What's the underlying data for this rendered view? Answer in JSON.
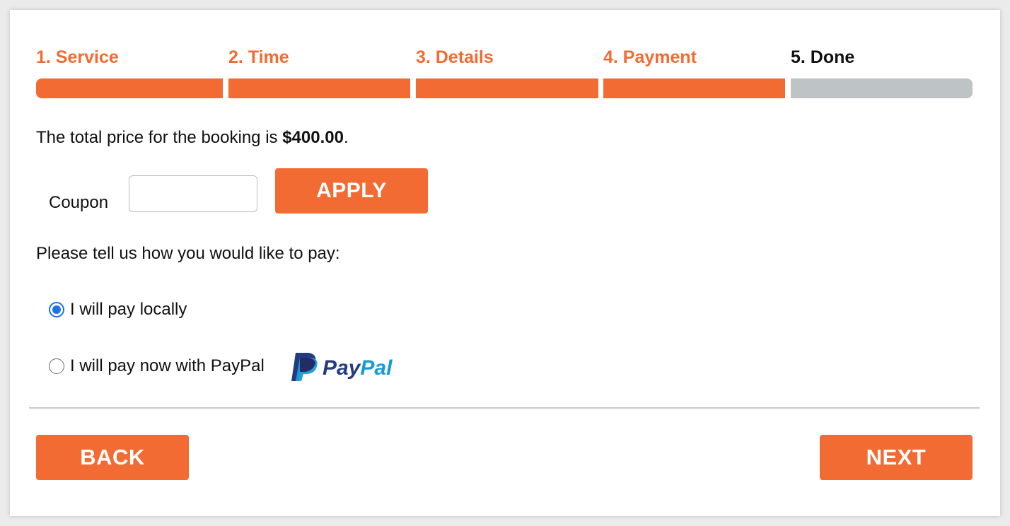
{
  "colors": {
    "accent": "#f26b32",
    "pending": "#bec3c6",
    "active_text": "#111111",
    "radio_checked": "#1a73e8"
  },
  "steps": [
    {
      "label": "1. Service",
      "state": "complete"
    },
    {
      "label": "2. Time",
      "state": "complete"
    },
    {
      "label": "3. Details",
      "state": "complete"
    },
    {
      "label": "4. Payment",
      "state": "complete"
    },
    {
      "label": "5. Done",
      "state": "pending"
    }
  ],
  "price": {
    "prefix": "The total price for the booking is ",
    "amount": "$400.00",
    "suffix": "."
  },
  "coupon": {
    "label": "Coupon",
    "value": "",
    "apply_label": "APPLY"
  },
  "payment": {
    "prompt": "Please tell us how you would like to pay:",
    "options": [
      {
        "label": "I will pay locally",
        "checked": true
      },
      {
        "label": "I will pay now with PayPal",
        "checked": false,
        "logo_icon": "paypal-logo-icon"
      }
    ],
    "paypal_wordmark": "PayPal"
  },
  "nav": {
    "back_label": "BACK",
    "next_label": "NEXT"
  }
}
